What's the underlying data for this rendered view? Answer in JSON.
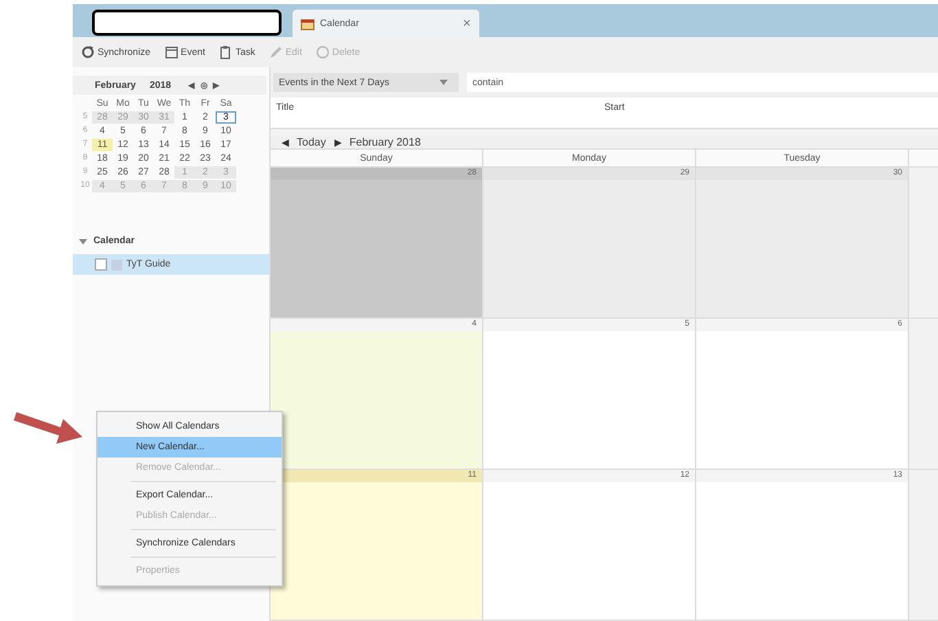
{
  "tabs": [
    {
      "kind": "blank",
      "selected": false
    },
    {
      "kind": "calendar",
      "label": "Calendar",
      "close": "×",
      "selected": true
    }
  ],
  "toolbar": [
    {
      "kind": "sync",
      "label": "Synchronize",
      "disabled": false
    },
    {
      "kind": "event",
      "label": "Event",
      "disabled": false
    },
    {
      "kind": "task",
      "label": "Task",
      "disabled": false
    },
    {
      "kind": "edit",
      "label": "Edit",
      "disabled": true
    },
    {
      "kind": "delete",
      "label": "Delete",
      "disabled": true
    }
  ],
  "minimonth": {
    "month": "February",
    "year": "2018",
    "prev": "◀",
    "today": "◎",
    "next": "▶",
    "weekdays": [
      "Su",
      "Mo",
      "Tu",
      "We",
      "Th",
      "Fr",
      "Sa"
    ],
    "weeks": [
      {
        "number": "5",
        "days": [
          {
            "label": "28",
            "outside": true,
            "today": false,
            "selected": false
          },
          {
            "label": "29",
            "outside": true,
            "today": false,
            "selected": false
          },
          {
            "label": "30",
            "outside": true,
            "today": false,
            "selected": false
          },
          {
            "label": "31",
            "outside": true,
            "today": false,
            "selected": false
          },
          {
            "label": "1",
            "outside": false,
            "today": false,
            "selected": false
          },
          {
            "label": "2",
            "outside": false,
            "today": false,
            "selected": false
          },
          {
            "label": "3",
            "outside": false,
            "today": false,
            "selected": true
          }
        ]
      },
      {
        "number": "6",
        "days": [
          {
            "label": "4",
            "outside": false,
            "today": false,
            "selected": false
          },
          {
            "label": "5",
            "outside": false,
            "today": false,
            "selected": false
          },
          {
            "label": "6",
            "outside": false,
            "today": false,
            "selected": false
          },
          {
            "label": "7",
            "outside": false,
            "today": false,
            "selected": false
          },
          {
            "label": "8",
            "outside": false,
            "today": false,
            "selected": false
          },
          {
            "label": "9",
            "outside": false,
            "today": false,
            "selected": false
          },
          {
            "label": "10",
            "outside": false,
            "today": false,
            "selected": false
          }
        ]
      },
      {
        "number": "7",
        "days": [
          {
            "label": "11",
            "outside": false,
            "today": true,
            "selected": false
          },
          {
            "label": "12",
            "outside": false,
            "today": false,
            "selected": false
          },
          {
            "label": "13",
            "outside": false,
            "today": false,
            "selected": false
          },
          {
            "label": "14",
            "outside": false,
            "today": false,
            "selected": false
          },
          {
            "label": "15",
            "outside": false,
            "today": false,
            "selected": false
          },
          {
            "label": "16",
            "outside": false,
            "today": false,
            "selected": false
          },
          {
            "label": "17",
            "outside": false,
            "today": false,
            "selected": false
          }
        ]
      },
      {
        "number": "8",
        "days": [
          {
            "label": "18",
            "outside": false,
            "today": false,
            "selected": false
          },
          {
            "label": "19",
            "outside": false,
            "today": false,
            "selected": false
          },
          {
            "label": "20",
            "outside": false,
            "today": false,
            "selected": false
          },
          {
            "label": "21",
            "outside": false,
            "today": false,
            "selected": false
          },
          {
            "label": "22",
            "outside": false,
            "today": false,
            "selected": false
          },
          {
            "label": "23",
            "outside": false,
            "today": false,
            "selected": false
          },
          {
            "label": "24",
            "outside": false,
            "today": false,
            "selected": false
          }
        ]
      },
      {
        "number": "9",
        "days": [
          {
            "label": "25",
            "outside": false,
            "today": false,
            "selected": false
          },
          {
            "label": "26",
            "outside": false,
            "today": false,
            "selected": false
          },
          {
            "label": "27",
            "outside": false,
            "today": false,
            "selected": false
          },
          {
            "label": "28",
            "outside": false,
            "today": false,
            "selected": false
          },
          {
            "label": "1",
            "outside": true,
            "today": false,
            "selected": false
          },
          {
            "label": "2",
            "outside": true,
            "today": false,
            "selected": false
          },
          {
            "label": "3",
            "outside": true,
            "today": false,
            "selected": false
          }
        ]
      },
      {
        "number": "10",
        "days": [
          {
            "label": "4",
            "outside": true,
            "today": false,
            "selected": false
          },
          {
            "label": "5",
            "outside": true,
            "today": false,
            "selected": false
          },
          {
            "label": "6",
            "outside": true,
            "today": false,
            "selected": false
          },
          {
            "label": "7",
            "outside": true,
            "today": false,
            "selected": false
          },
          {
            "label": "8",
            "outside": true,
            "today": false,
            "selected": false
          },
          {
            "label": "9",
            "outside": true,
            "today": false,
            "selected": false
          },
          {
            "label": "10",
            "outside": true,
            "today": false,
            "selected": false
          }
        ]
      }
    ]
  },
  "calendars": {
    "heading": "Calendar",
    "expanded": true,
    "items": [
      {
        "name": "TyT Guide",
        "selected": true,
        "checked": false,
        "color": "#c5d0e4"
      }
    ]
  },
  "filter": {
    "selection": "Events in the Next 7 Days",
    "placeholder": "contain"
  },
  "list_columns": [
    "Title",
    "Start"
  ],
  "nav": {
    "prev": "◀",
    "today": "Today",
    "next": "▶",
    "period": "February 2018"
  },
  "month_view": {
    "days": [
      "Sunday",
      "Monday",
      "Tuesday"
    ],
    "weeks": [
      {
        "cells": [
          {
            "label": "28",
            "outside": true,
            "weekend": true,
            "today": false
          },
          {
            "label": "29",
            "outside": true,
            "weekend": false,
            "today": false
          },
          {
            "label": "30",
            "outside": true,
            "weekend": false,
            "today": false
          }
        ]
      },
      {
        "cells": [
          {
            "label": "4",
            "outside": false,
            "weekend": true,
            "today": false
          },
          {
            "label": "5",
            "outside": false,
            "weekend": false,
            "today": false
          },
          {
            "label": "6",
            "outside": false,
            "weekend": false,
            "today": false
          }
        ]
      },
      {
        "cells": [
          {
            "label": "11",
            "outside": false,
            "weekend": true,
            "today": true
          },
          {
            "label": "12",
            "outside": false,
            "weekend": false,
            "today": false
          },
          {
            "label": "13",
            "outside": false,
            "weekend": false,
            "today": false
          }
        ]
      }
    ]
  },
  "context_menu": [
    {
      "kind": "item",
      "label": "Show All Calendars",
      "selected": false,
      "disabled": false
    },
    {
      "kind": "item",
      "label": "New Calendar...",
      "selected": true,
      "disabled": false
    },
    {
      "kind": "item",
      "label": "Remove Calendar...",
      "selected": false,
      "disabled": true
    },
    {
      "kind": "separator"
    },
    {
      "kind": "item",
      "label": "Export Calendar...",
      "selected": false,
      "disabled": false
    },
    {
      "kind": "item",
      "label": "Publish Calendar...",
      "selected": false,
      "disabled": true
    },
    {
      "kind": "separator"
    },
    {
      "kind": "item",
      "label": "Synchronize Calendars",
      "selected": false,
      "disabled": false
    },
    {
      "kind": "separator"
    },
    {
      "kind": "item",
      "label": "Properties",
      "selected": false,
      "disabled": true
    }
  ]
}
